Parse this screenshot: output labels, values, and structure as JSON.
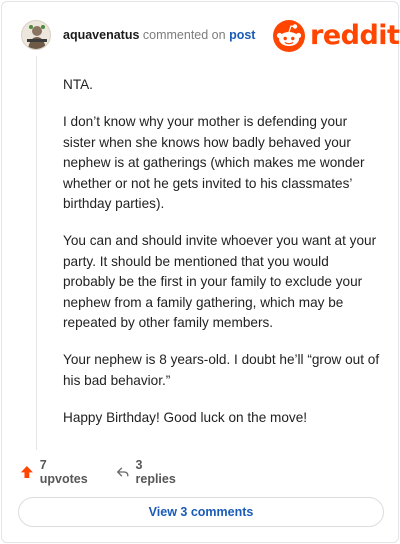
{
  "comment": {
    "username": "aquavenatus",
    "commented_text": "commented on",
    "post_link": "post",
    "paragraphs": [
      "NTA.",
      "I don’t know why your mother is defending your sister when she knows how badly behaved your nephew is at gatherings (which makes me wonder whether or not he gets invited to his classmates’ birthday parties).",
      "You can and should invite whoever you want at your party. It should be mentioned that you would probably be the first in your family to exclude your nephew from a family gathering, which may be repeated by other family members.",
      "Your nephew is 8 years-old. I doubt he’ll “grow out of his bad behavior.”",
      "Happy Birthday! Good luck on the move!"
    ]
  },
  "brand": {
    "logo_text": "reddit",
    "color": "#ff4500"
  },
  "actions": {
    "upvotes_label": "7 upvotes",
    "upvote_icon": "upvote-arrow-icon",
    "replies_label": "3 replies",
    "reply_icon": "reply-arrow-icon"
  },
  "view_comments_label": "View 3 comments",
  "colors": {
    "accent": "#ff4500",
    "link": "#1a5bb8",
    "upvote": "#ff4500"
  }
}
